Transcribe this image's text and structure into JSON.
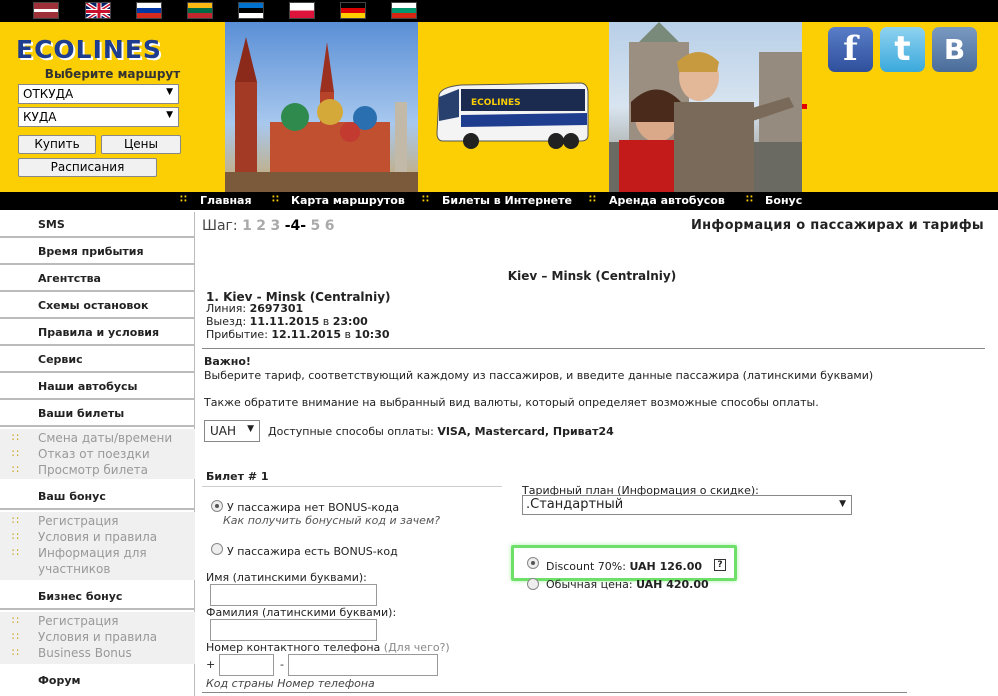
{
  "header": {
    "logo": "ECOLINES",
    "route_title": "Выберите маршрут",
    "from_select": "ОТКУДА",
    "to_select": "КУДА",
    "buy_button": "Купить",
    "prices_button": "Цены",
    "schedule_button": "Расписания",
    "bus_text": "ECOLINES"
  },
  "social": {
    "facebook": "f",
    "twitter": "t",
    "vk": "B"
  },
  "nav": [
    "Главная",
    "Карта маршрутов",
    "Билеты в Интернете",
    "Аренда автобусов",
    "Бонус"
  ],
  "sidebar": {
    "items": [
      "SMS",
      "Время прибытия",
      "Агентства",
      "Схемы остановок",
      "Правила и условия",
      "Сервис",
      "Наши автобусы",
      "Ваши билеты"
    ],
    "tickets_sub": [
      "Смена даты/времени",
      "Отказ от поездки",
      "Просмотр билета"
    ],
    "bonus_title": "Ваш бонус",
    "bonus_sub": [
      "Регистрация",
      "Условия и правила",
      "Информация для",
      "участников"
    ],
    "business_title": "Бизнес бонус",
    "business_sub": [
      "Регистрация",
      "Условия и правила",
      "Business Bonus"
    ],
    "forum": "Форум"
  },
  "main": {
    "step_label": "Шаг:",
    "step_1": "1",
    "step_2": "2",
    "step_3": "3",
    "step_4": "-4-",
    "step_5": "5",
    "step_6": "6",
    "page_title": "Информация о пассажирах и тарифы",
    "route": "Kiev – Minsk (Centralniy)",
    "trip_title": "1. Kiev - Minsk (Centralniy)",
    "line_label": "Линия:",
    "line_value": "2697301",
    "depart_label": "Выезд:",
    "depart_date": "11.11.2015",
    "depart_in": "в",
    "depart_time": "23:00",
    "arrive_label": "Прибытие:",
    "arrive_date": "12.11.2015",
    "arrive_in": "в",
    "arrive_time": "10:30",
    "important": "Важно!",
    "instr1": "Выберите тариф, соответствующий каждому из пассажиров, и введите данные пассажира (латинскими буквами)",
    "instr2": "Также обратите внимание на выбранный вид валюты, который определяет возможные способы оплаты.",
    "currency": "UAH",
    "payment_label": "Доступные способы оплаты:",
    "payment_methods": "VISA, Mastercard, Приват24",
    "ticket_title": "Билет # 1",
    "no_bonus": "У пассажира нет BONUS-кода",
    "bonus_link": "Как получить бонусный код и зачем?",
    "has_bonus": "У пассажира есть BONUS-код",
    "name_label": "Имя (латинскими буквами):",
    "surname_label": "Фамилия (латинскими буквами):",
    "phone_label": "Номер контактного телефона",
    "phone_why": "(Для чего?)",
    "plus": "+",
    "dash": "-",
    "phone_hint": "Код страны Номер телефона",
    "tariff_label": "Тарифный план (Информация о скидке):",
    "tariff_value": ".Стандартный",
    "discount_label": "Discount 70%:",
    "discount_price": "UAH 126.00",
    "help": "?",
    "normal_label": "Обычная цена:",
    "normal_price": "UAH 420.00"
  }
}
